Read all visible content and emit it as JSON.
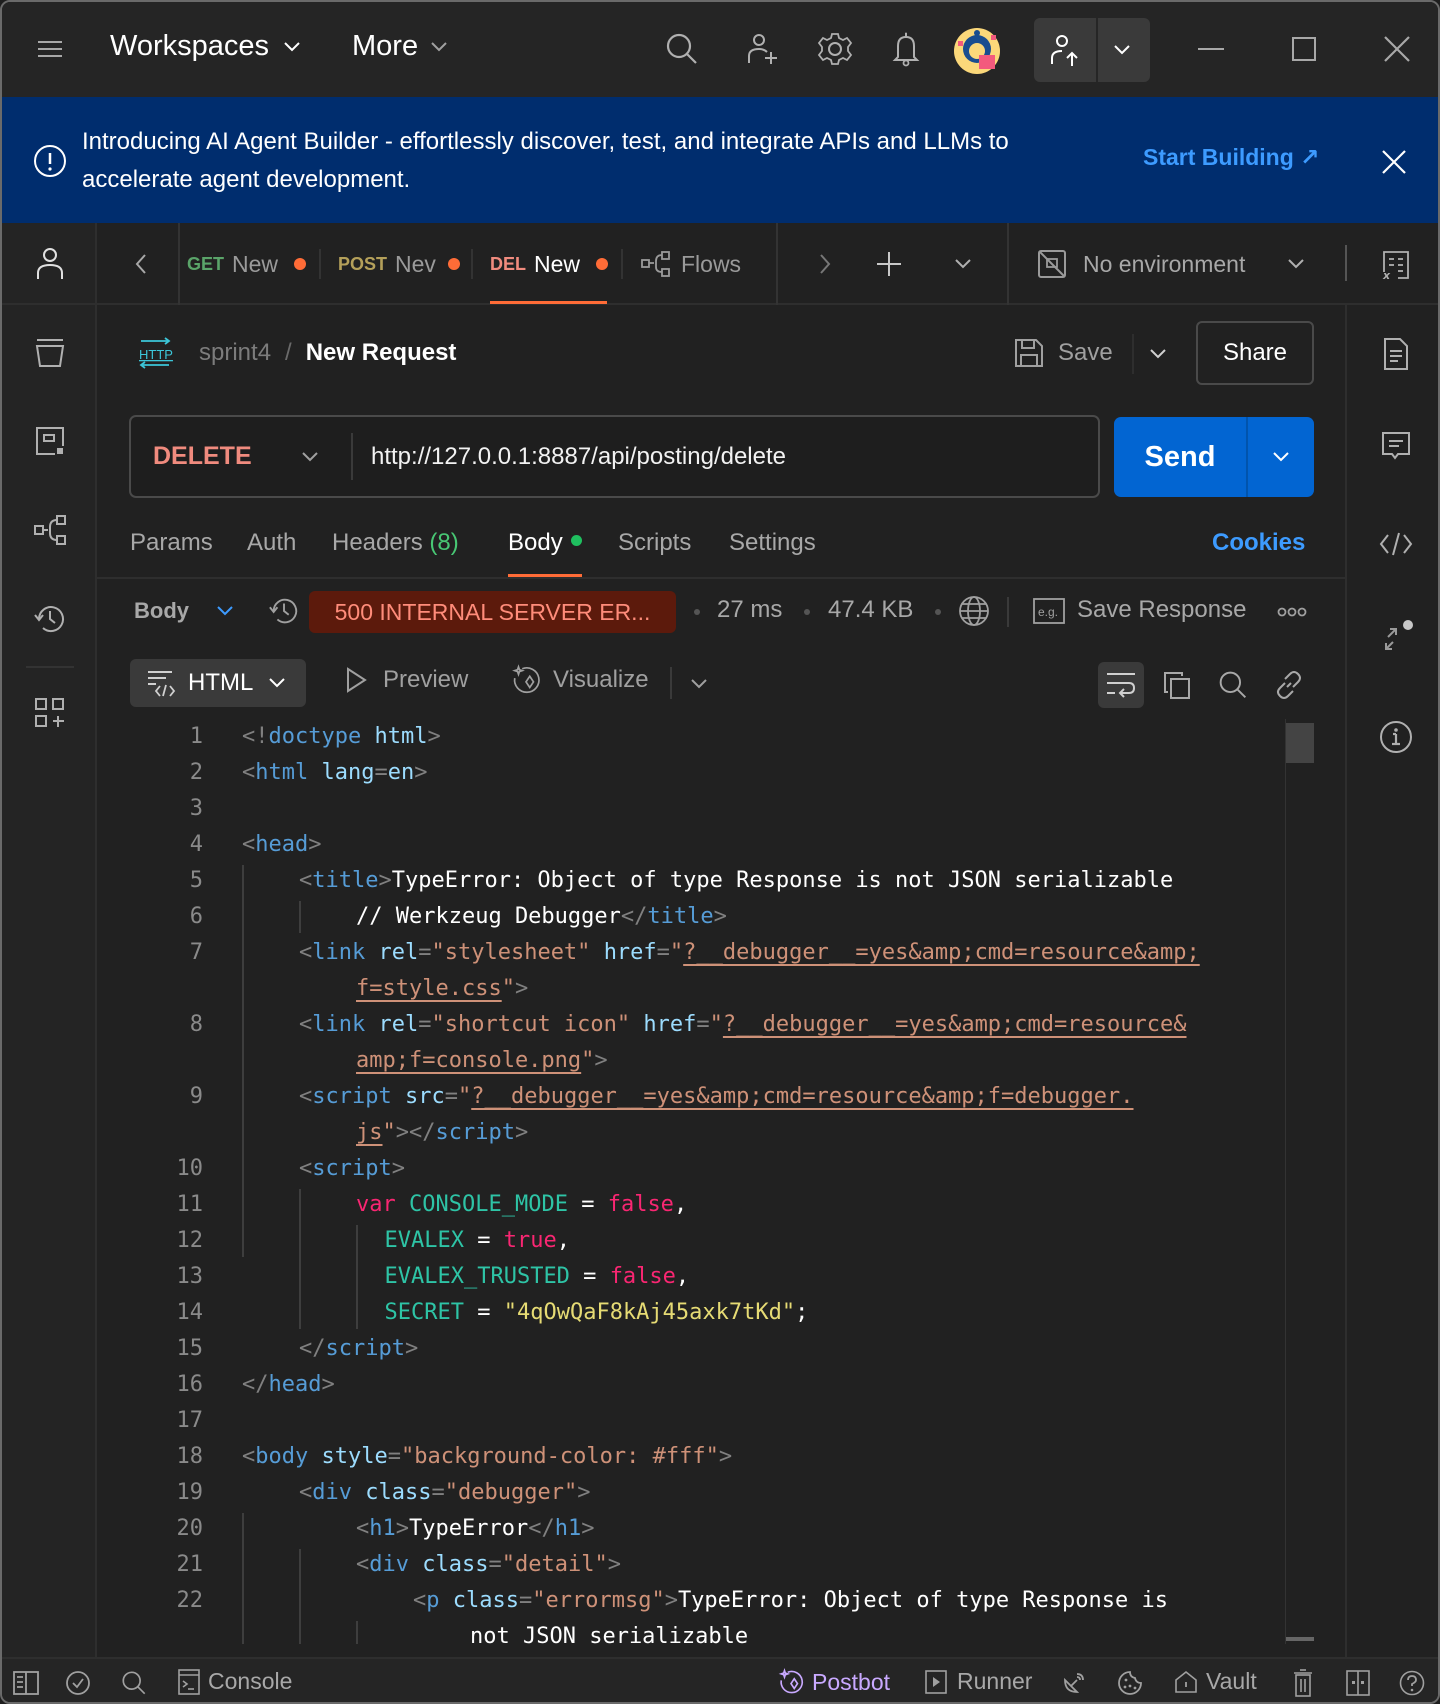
{
  "titlebar": {
    "workspaces_label": "Workspaces",
    "more_label": "More",
    "icons": [
      "menu-icon",
      "search-icon",
      "invite-user-icon",
      "settings-icon",
      "notifications-icon",
      "avatar",
      "upgrade-icon",
      "minimize-icon",
      "maximize-icon",
      "close-icon"
    ]
  },
  "banner": {
    "text": "Introducing AI Agent Builder - effortlessly discover, test, and integrate APIs and LLMs to accelerate agent development.",
    "link_label": "Start Building ↗"
  },
  "tabs": {
    "items": [
      {
        "method": "GET",
        "name": "New",
        "method_color": "#5aa469",
        "unsaved": true,
        "active": false
      },
      {
        "method": "POST",
        "name": "Nev",
        "method_color": "#b4a05a",
        "unsaved": true,
        "active": false
      },
      {
        "method": "DEL",
        "name": "New",
        "method_color": "#f08b7e",
        "unsaved": true,
        "active": true
      }
    ],
    "flows_label": "Flows",
    "environment_label": "No environment"
  },
  "request": {
    "collection": "sprint4",
    "separator": "/",
    "name": "New Request",
    "save_label": "Save",
    "share_label": "Share",
    "method": "DELETE",
    "url": "http://127.0.0.1:8887/api/posting/delete",
    "send_label": "Send"
  },
  "request_tabs": {
    "params": "Params",
    "auth": "Auth",
    "headers": "Headers",
    "headers_count": "(8)",
    "body": "Body",
    "scripts": "Scripts",
    "settings": "Settings",
    "cookies": "Cookies"
  },
  "response": {
    "view_label": "Body",
    "status": "500 INTERNAL SERVER ER...",
    "time": "27 ms",
    "size": "47.4 KB",
    "save_response_label": "Save Response",
    "format": "HTML",
    "preview_label": "Preview",
    "visualize_label": "Visualize"
  },
  "code_lines": [
    {
      "n": "1",
      "indent": 0,
      "tokens": [
        [
          "p",
          "<!"
        ],
        [
          "tag",
          "doctype"
        ],
        [
          "p",
          " "
        ],
        [
          "attr",
          "html"
        ],
        [
          "p",
          ">"
        ]
      ]
    },
    {
      "n": "2",
      "indent": 0,
      "tokens": [
        [
          "p",
          "<"
        ],
        [
          "tag",
          "html"
        ],
        [
          "p",
          " "
        ],
        [
          "attr",
          "lang"
        ],
        [
          "p",
          "="
        ],
        [
          "attr",
          "en"
        ],
        [
          "p",
          ">"
        ]
      ]
    },
    {
      "n": "3",
      "indent": 0,
      "tokens": []
    },
    {
      "n": "4",
      "indent": 0,
      "tokens": [
        [
          "p",
          "<"
        ],
        [
          "tag",
          "head"
        ],
        [
          "p",
          ">"
        ]
      ]
    },
    {
      "n": "5",
      "indent": 1,
      "tokens": [
        [
          "p",
          "<"
        ],
        [
          "tag",
          "title"
        ],
        [
          "p",
          ">"
        ],
        [
          "txt",
          "TypeError: Object of type Response is not JSON serializable"
        ]
      ]
    },
    {
      "n": "6",
      "indent": 2,
      "tokens": [
        [
          "txt",
          "// Werkzeug Debugger"
        ],
        [
          "p",
          "</"
        ],
        [
          "tag",
          "title"
        ],
        [
          "p",
          ">"
        ]
      ],
      "wrapped": true
    },
    {
      "n": "7",
      "indent": 1,
      "tokens": [
        [
          "p",
          "<"
        ],
        [
          "tag",
          "link"
        ],
        [
          "p",
          " "
        ],
        [
          "attr",
          "rel"
        ],
        [
          "p",
          "="
        ],
        [
          "str",
          "\"stylesheet\""
        ],
        [
          "p",
          " "
        ],
        [
          "attr",
          "href"
        ],
        [
          "p",
          "="
        ],
        [
          "str",
          "\""
        ],
        [
          "link",
          "?__debugger__=yes&amp;cmd=resource&amp;"
        ]
      ]
    },
    {
      "n": "",
      "indent": 2,
      "tokens": [
        [
          "link",
          "f=style.css"
        ],
        [
          "str",
          "\""
        ],
        [
          "p",
          ">"
        ]
      ]
    },
    {
      "n": "8",
      "indent": 1,
      "tokens": [
        [
          "p",
          "<"
        ],
        [
          "tag",
          "link"
        ],
        [
          "p",
          " "
        ],
        [
          "attr",
          "rel"
        ],
        [
          "p",
          "="
        ],
        [
          "str",
          "\"shortcut icon\""
        ],
        [
          "p",
          " "
        ],
        [
          "attr",
          "href"
        ],
        [
          "p",
          "="
        ],
        [
          "str",
          "\""
        ],
        [
          "link",
          "?__debugger__=yes&amp;cmd=resource&"
        ]
      ]
    },
    {
      "n": "",
      "indent": 2,
      "tokens": [
        [
          "link",
          "amp;f=console.png"
        ],
        [
          "str",
          "\""
        ],
        [
          "p",
          ">"
        ]
      ]
    },
    {
      "n": "9",
      "indent": 1,
      "tokens": [
        [
          "p",
          "<"
        ],
        [
          "tag",
          "script"
        ],
        [
          "p",
          " "
        ],
        [
          "attr",
          "src"
        ],
        [
          "p",
          "="
        ],
        [
          "str",
          "\""
        ],
        [
          "link",
          "?__debugger__=yes&amp;cmd=resource&amp;f=debugger."
        ]
      ]
    },
    {
      "n": "",
      "indent": 2,
      "tokens": [
        [
          "link",
          "js"
        ],
        [
          "str",
          "\""
        ],
        [
          "p",
          "></"
        ],
        [
          "tag",
          "script"
        ],
        [
          "p",
          ">"
        ]
      ]
    },
    {
      "n": "10",
      "indent": 1,
      "tokens": [
        [
          "p",
          "<"
        ],
        [
          "tag",
          "script"
        ],
        [
          "p",
          ">"
        ]
      ]
    },
    {
      "n": "11",
      "indent": 2,
      "tokens": [
        [
          "kw",
          "var"
        ],
        [
          "txt",
          " "
        ],
        [
          "var",
          "CONSOLE_MODE"
        ],
        [
          "txt",
          " = "
        ],
        [
          "kw",
          "false"
        ],
        [
          "txt",
          ","
        ]
      ]
    },
    {
      "n": "12",
      "indent": 2.5,
      "tokens": [
        [
          "var",
          "EVALEX"
        ],
        [
          "txt",
          " = "
        ],
        [
          "kw",
          "true"
        ],
        [
          "txt",
          ","
        ]
      ]
    },
    {
      "n": "13",
      "indent": 2.5,
      "tokens": [
        [
          "var",
          "EVALEX_TRUSTED"
        ],
        [
          "txt",
          " = "
        ],
        [
          "kw",
          "false"
        ],
        [
          "txt",
          ","
        ]
      ]
    },
    {
      "n": "14",
      "indent": 2.5,
      "tokens": [
        [
          "var",
          "SECRET"
        ],
        [
          "txt",
          " = "
        ],
        [
          "yel",
          "\"4qOwQaF8kAj45axk7tKd\""
        ],
        [
          "txt",
          ";"
        ]
      ]
    },
    {
      "n": "15",
      "indent": 1,
      "tokens": [
        [
          "p",
          "</"
        ],
        [
          "tag",
          "script"
        ],
        [
          "p",
          ">"
        ]
      ]
    },
    {
      "n": "16",
      "indent": 0,
      "tokens": [
        [
          "p",
          "</"
        ],
        [
          "tag",
          "head"
        ],
        [
          "p",
          ">"
        ]
      ]
    },
    {
      "n": "17",
      "indent": 0,
      "tokens": []
    },
    {
      "n": "18",
      "indent": 0,
      "tokens": [
        [
          "p",
          "<"
        ],
        [
          "tag",
          "body"
        ],
        [
          "p",
          " "
        ],
        [
          "attr",
          "style"
        ],
        [
          "p",
          "="
        ],
        [
          "str",
          "\"background-color: #fff\""
        ],
        [
          "p",
          ">"
        ]
      ]
    },
    {
      "n": "19",
      "indent": 1,
      "tokens": [
        [
          "p",
          "<"
        ],
        [
          "tag",
          "div"
        ],
        [
          "p",
          " "
        ],
        [
          "attr",
          "class"
        ],
        [
          "p",
          "="
        ],
        [
          "str",
          "\"debugger\""
        ],
        [
          "p",
          ">"
        ]
      ]
    },
    {
      "n": "20",
      "indent": 2,
      "tokens": [
        [
          "p",
          "<"
        ],
        [
          "tag",
          "h1"
        ],
        [
          "p",
          ">"
        ],
        [
          "txt",
          "TypeError"
        ],
        [
          "p",
          "</"
        ],
        [
          "tag",
          "h1"
        ],
        [
          "p",
          ">"
        ]
      ]
    },
    {
      "n": "21",
      "indent": 2,
      "tokens": [
        [
          "p",
          "<"
        ],
        [
          "tag",
          "div"
        ],
        [
          "p",
          " "
        ],
        [
          "attr",
          "class"
        ],
        [
          "p",
          "="
        ],
        [
          "str",
          "\"detail\""
        ],
        [
          "p",
          ">"
        ]
      ]
    },
    {
      "n": "22",
      "indent": 3,
      "tokens": [
        [
          "p",
          "<"
        ],
        [
          "tag",
          "p"
        ],
        [
          "p",
          " "
        ],
        [
          "attr",
          "class"
        ],
        [
          "p",
          "="
        ],
        [
          "str",
          "\"errormsg\""
        ],
        [
          "p",
          ">"
        ],
        [
          "txt",
          "TypeError: Object of type Response is"
        ]
      ]
    },
    {
      "n": "",
      "indent": 4,
      "tokens": [
        [
          "txt",
          "not JSON serializable"
        ]
      ]
    }
  ],
  "statusbar": {
    "console_label": "Console",
    "postbot_label": "Postbot",
    "runner_label": "Runner",
    "vault_label": "Vault"
  },
  "colors": {
    "accent": "#ff6c37",
    "send": "#0265d2",
    "banner": "#002d6e",
    "link": "#3d9bff",
    "error_badge_bg": "#5c1a0c",
    "error_badge_text": "#ff8c7a"
  }
}
